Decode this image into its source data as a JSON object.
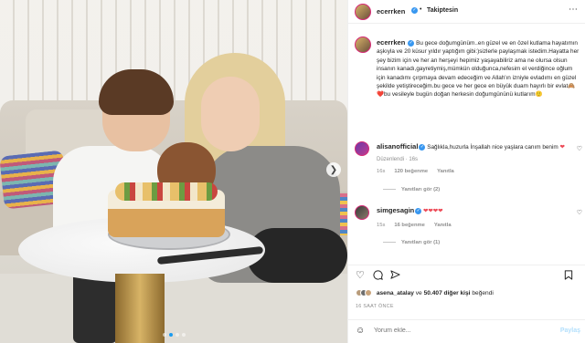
{
  "header": {
    "username": "ecerrken",
    "verified_icon": "verified-badge-icon",
    "separator": "•",
    "follow_label": "Takiptesin",
    "more_icon": "more-horizontal-icon"
  },
  "caption": {
    "username": "ecerrken",
    "text": "Bu gece doğumgünüm..en güzel ve en özel kutlama hayatımın aşkıyla ve 20 küsur yıldır yaptığım gibi:)sizlerle paylaşmak istedim.Hayatta her şey bizim için ve her an herşeyi hepimiz yaşayabiliriz ama ne olursa olsun insanın kanadı,gayretiymiş,mümkün olduğunca,nefesim el verdiğince oğlum için kanadımı çırpmaya devam edeceğim ve Allah'ın izniyle evladımı en güzel şekilde yetiştireceğim.bu gece ve her gece en büyük duam hayırlı bir evlat",
    "emoji_text": "🙈❤️",
    "text_end": "bu vesileyle bugün doğan herkesin doğumgününü kutlarım",
    "end_emoji": "🙂",
    "edited": "Düzenlendi",
    "dot": "·",
    "age": "16s"
  },
  "comments": [
    {
      "username": "alisanofficial",
      "text": "Sağlıkla,huzurla İnşallah nice yaşlara canım benim",
      "hearts": "❤",
      "age": "16s",
      "likes": "120 beğenme",
      "reply": "Yanıtla",
      "view_replies": "Yanıtları gör (2)"
    },
    {
      "username": "simgesagin",
      "hearts": "❤❤❤❤",
      "age": "15s",
      "likes": "16 beğenme",
      "reply": "Yanıtla",
      "view_replies": "Yanıtları gör (1)"
    }
  ],
  "actions": {
    "like_icon": "heart-icon",
    "comment_icon": "comment-icon",
    "share_icon": "share-icon",
    "save_icon": "bookmark-icon"
  },
  "likes": {
    "liked_by_user": "asena_atalay",
    "connector": "ve",
    "count": "50.407 diğer kişi",
    "suffix": "beğendi"
  },
  "timestamp": "16 SAAT ÖNCE",
  "add_comment": {
    "placeholder": "Yorum ekle...",
    "post_label": "Paylaş",
    "emoji_icon": "smiley-icon"
  },
  "carousel": {
    "next_icon": "chevron-right-icon",
    "slide_count": 4,
    "active_index": 1
  },
  "colors": {
    "link_blue": "#3897f0",
    "post_disabled": "#b2dffc",
    "heart_red": "#ed4956",
    "muted_text": "#8e8e8e"
  }
}
